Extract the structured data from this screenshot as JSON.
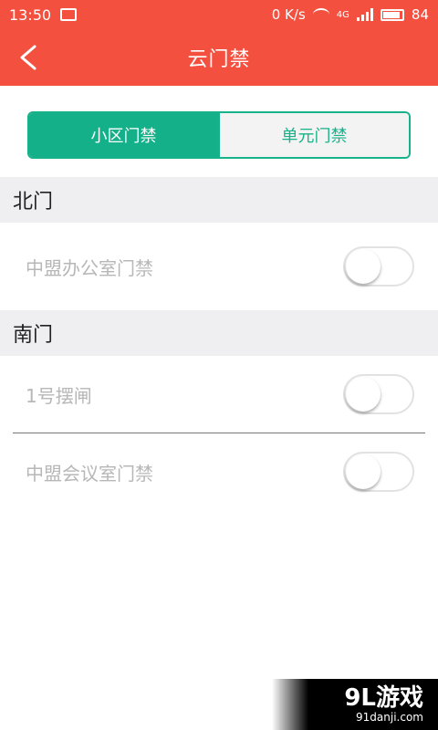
{
  "status_bar": {
    "time": "13:50",
    "data_speed": "0 K/s",
    "network": "4G",
    "battery": "84"
  },
  "header": {
    "title": "云门禁",
    "back_icon": "chevron-left-icon"
  },
  "tabs": [
    {
      "label": "小区门禁",
      "active": true
    },
    {
      "label": "单元门禁",
      "active": false
    }
  ],
  "sections": [
    {
      "title": "北门",
      "items": [
        {
          "label": "中盟办公室门禁",
          "enabled": false
        }
      ]
    },
    {
      "title": "南门",
      "items": [
        {
          "label": "1号摆闸",
          "enabled": false
        },
        {
          "label": "中盟会议室门禁",
          "enabled": false
        }
      ]
    }
  ],
  "watermark": {
    "brand": "9L游戏",
    "url": "91danji.com"
  },
  "colors": {
    "accent_red": "#f4503f",
    "accent_green": "#13b089"
  }
}
